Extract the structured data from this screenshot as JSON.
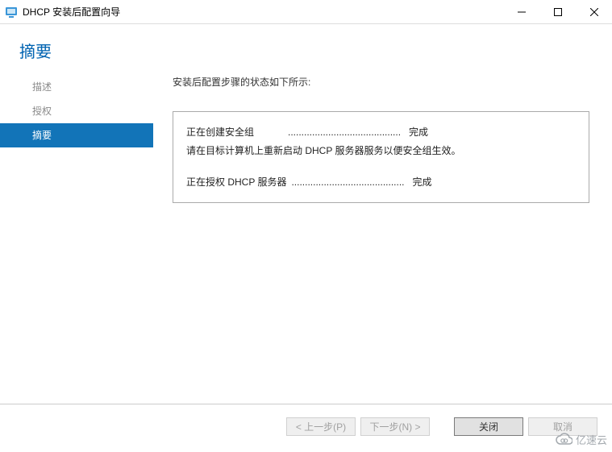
{
  "window": {
    "title": "DHCP 安装后配置向导"
  },
  "header": {
    "title": "摘要"
  },
  "sidebar": {
    "items": [
      {
        "label": "描述",
        "active": false
      },
      {
        "label": "授权",
        "active": false
      },
      {
        "label": "摘要",
        "active": true
      }
    ]
  },
  "main": {
    "intro": "安装后配置步骤的状态如下所示:",
    "summary": {
      "line1": {
        "label": "正在创建安全组",
        "dots": "..........................................",
        "status": "完成"
      },
      "info": "请在目标计算机上重新启动 DHCP 服务器服务以便安全组生效。",
      "line2": {
        "label": "正在授权 DHCP 服务器",
        "dots": "..........................................",
        "status": "完成"
      }
    }
  },
  "buttons": {
    "prev": "< 上一步(P)",
    "next": "下一步(N) >",
    "close": "关闭",
    "cancel": "取消"
  },
  "watermark": "亿速云"
}
